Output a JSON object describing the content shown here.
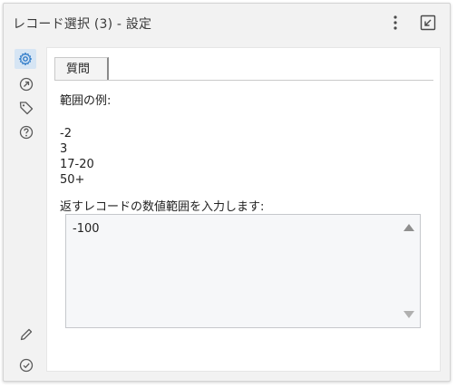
{
  "window": {
    "title": "レコード選択 (3) - 設定"
  },
  "toolbar": {
    "more_icon": "kebab-vertical-icon",
    "undock_icon": "undock-window-icon"
  },
  "sidebar": {
    "items": [
      {
        "icon": "gear-icon",
        "active": true
      },
      {
        "icon": "arrow-circle-icon",
        "active": false
      },
      {
        "icon": "tag-icon",
        "active": false
      },
      {
        "icon": "help-circle-icon",
        "active": false
      },
      {
        "icon": "pencil-icon",
        "active": false
      },
      {
        "icon": "check-circle-icon",
        "active": false
      }
    ]
  },
  "tabs": [
    {
      "label": "質問",
      "selected": true
    }
  ],
  "question": {
    "examples_heading": "範囲の例:",
    "examples": [
      "-2",
      "3",
      "17-20",
      "50+"
    ],
    "prompt": "返すレコードの数値範囲を入力します:",
    "input_value": "-100"
  },
  "colors": {
    "accent_active_bg": "#d6e5f4",
    "icon_blue": "#2f7bc8",
    "icon_gray": "#5a5a5a"
  }
}
